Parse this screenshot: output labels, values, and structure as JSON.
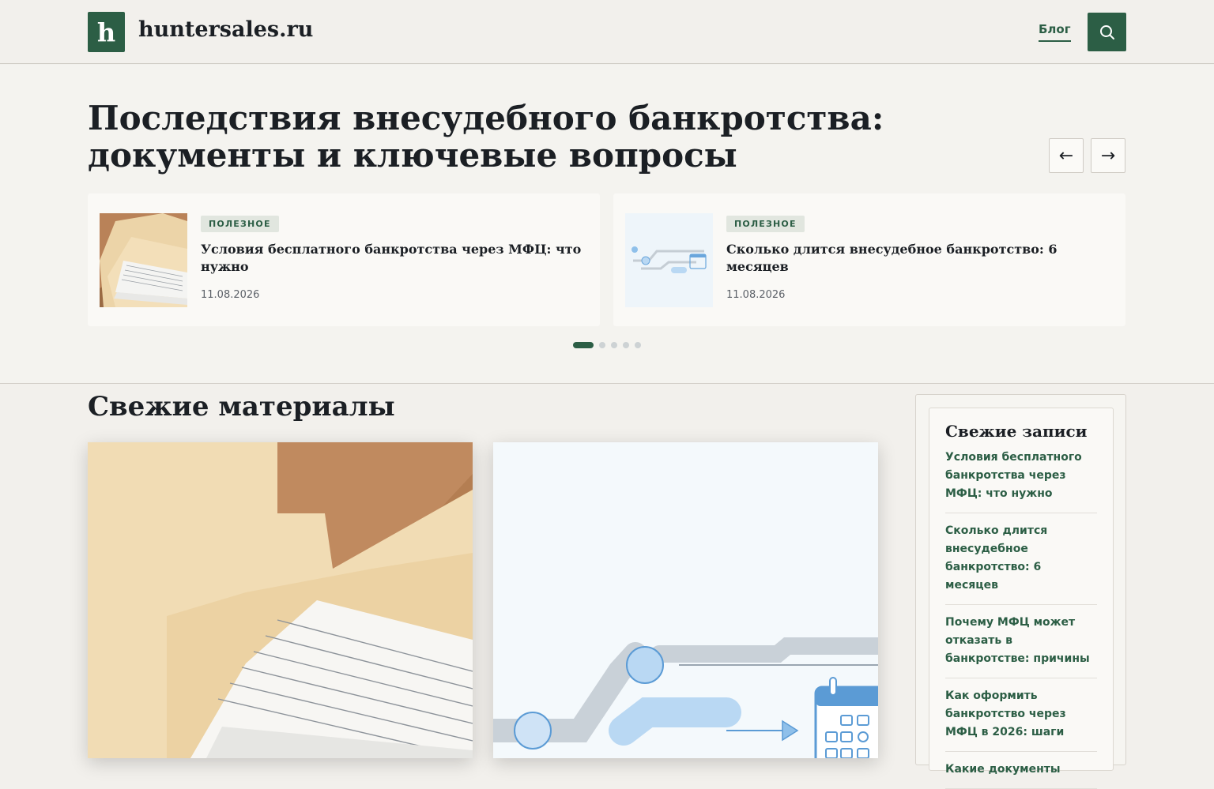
{
  "header": {
    "logo_letter": "h",
    "site_name": "huntersales.ru",
    "nav_blog": "Блог",
    "search_icon": "search-icon"
  },
  "hero": {
    "title": "Последствия внесудебного банкротства: документы и ключевые вопросы",
    "prev_arrow": "←",
    "next_arrow": "→",
    "cards": [
      {
        "badge": "ПОЛЕЗНОЕ",
        "title": "Условия бесплатного банкротства через МФЦ: что нужно",
        "date": "11.08.2026"
      },
      {
        "badge": "ПОЛЕЗНОЕ",
        "title": "Сколько длится внесудебное банкротство: 6 месяцев",
        "date": "11.08.2026"
      }
    ],
    "pagination": {
      "total": 5,
      "active": 1
    }
  },
  "main": {
    "section_title": "Свежие материалы"
  },
  "sidebar": {
    "title": "Свежие записи",
    "items": [
      "Условия бесплатного банкротства через МФЦ: что нужно",
      "Сколько длится внесудебное банкротство: 6 месяцев",
      "Почему МФЦ может отказать в банкротстве: причины",
      "Как оформить банкротство через МФЦ в 2026: шаги",
      "Какие документы"
    ]
  },
  "colors": {
    "brand": "#2c5e45",
    "background": "#f2f0ec",
    "text": "#1b1f24"
  }
}
